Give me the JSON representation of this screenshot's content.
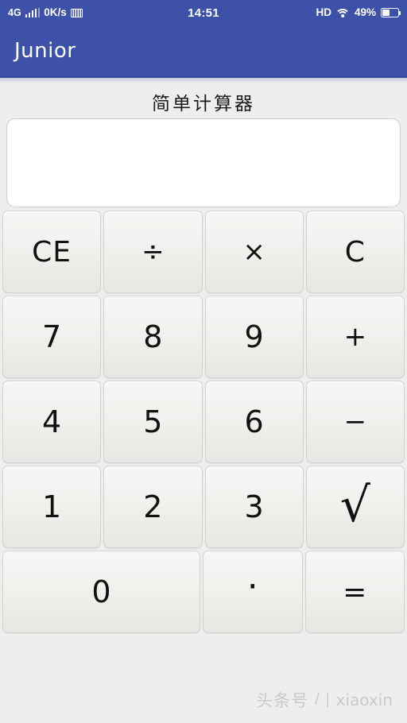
{
  "status_bar": {
    "network_type": "4G",
    "data_speed": "0K/s",
    "time": "14:51",
    "hd_label": "HD",
    "battery_percent": "49%",
    "battery_level": 49,
    "signal_bars": 4,
    "icons": {
      "signal": "signal-bars-icon",
      "speed_badge": "data-badge-icon",
      "wifi": "wifi-icon",
      "battery": "battery-icon"
    },
    "colors": {
      "background": "#3d51a8",
      "foreground": "#ffffff"
    }
  },
  "app_bar": {
    "title": "Junior",
    "background": "#3d51a8"
  },
  "page": {
    "heading": "简单计算器"
  },
  "display": {
    "value": "",
    "placeholder": ""
  },
  "keypad": {
    "rows": [
      [
        {
          "label": "CE",
          "name": "key-clear-entry",
          "kind": "ce"
        },
        {
          "label": "÷",
          "name": "key-divide",
          "kind": "op-small"
        },
        {
          "label": "×",
          "name": "key-multiply",
          "kind": "op-small"
        },
        {
          "label": "C",
          "name": "key-clear",
          "kind": "ce"
        }
      ],
      [
        {
          "label": "7",
          "name": "key-7",
          "kind": "digit"
        },
        {
          "label": "8",
          "name": "key-8",
          "kind": "digit"
        },
        {
          "label": "9",
          "name": "key-9",
          "kind": "digit"
        },
        {
          "label": "+",
          "name": "key-plus",
          "kind": "op-small"
        }
      ],
      [
        {
          "label": "4",
          "name": "key-4",
          "kind": "digit"
        },
        {
          "label": "5",
          "name": "key-5",
          "kind": "digit"
        },
        {
          "label": "6",
          "name": "key-6",
          "kind": "digit"
        },
        {
          "label": "−",
          "name": "key-minus",
          "kind": "op-small"
        }
      ],
      [
        {
          "label": "1",
          "name": "key-1",
          "kind": "digit"
        },
        {
          "label": "2",
          "name": "key-2",
          "kind": "digit"
        },
        {
          "label": "3",
          "name": "key-3",
          "kind": "digit"
        },
        {
          "label": "√",
          "name": "key-square-root",
          "kind": "sqrt"
        }
      ],
      [
        {
          "label": "0",
          "name": "key-0",
          "kind": "wide"
        },
        {
          "label": "·",
          "name": "key-decimal",
          "kind": "dot"
        },
        {
          "label": "=",
          "name": "key-equals",
          "kind": "eq"
        }
      ]
    ]
  },
  "footer": {
    "cn_label": "头条号",
    "slash": "/",
    "bar": "|",
    "author": "xiaoxin"
  }
}
